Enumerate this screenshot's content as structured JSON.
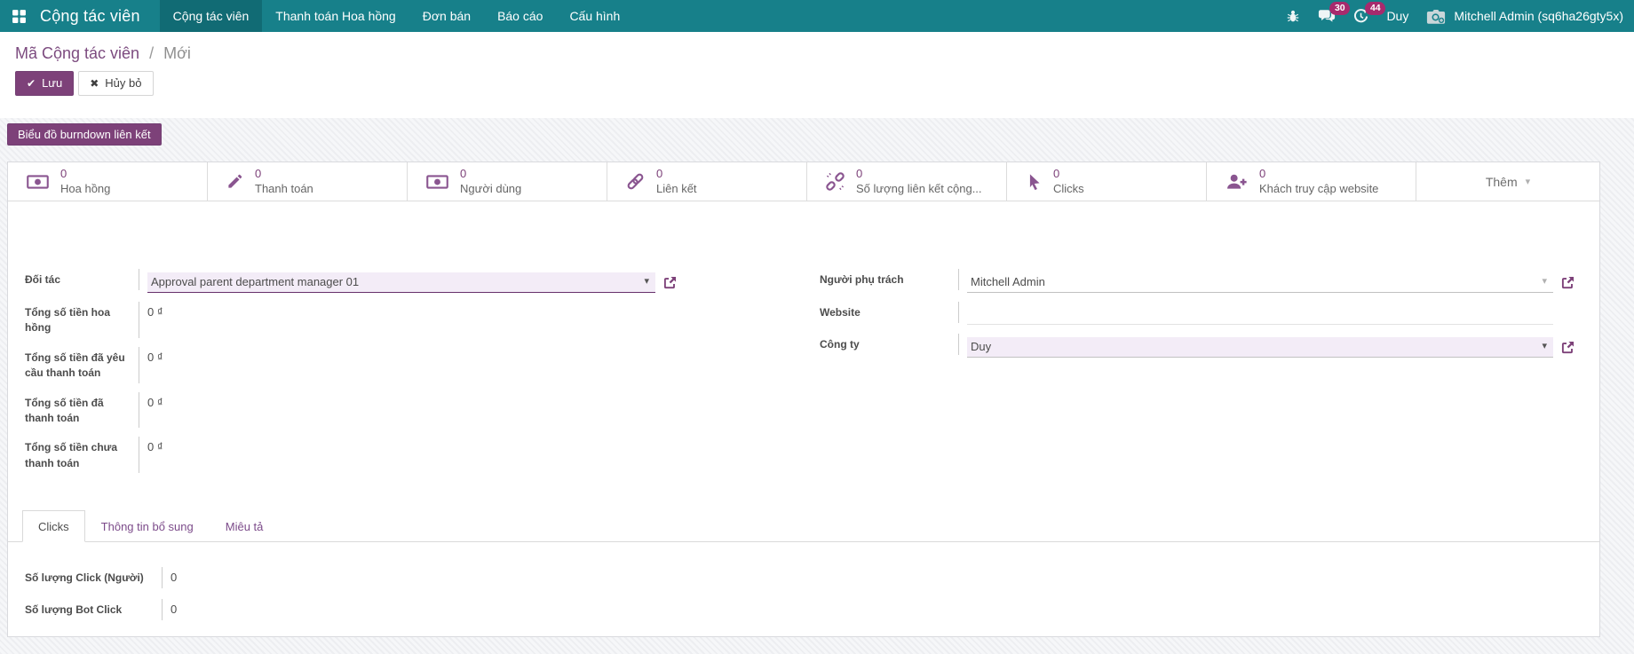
{
  "colors": {
    "topbar_bg": "#17808a",
    "topbar_active_bg": "#116b74",
    "accent_purple": "#7d4179",
    "badge_magenta": "#a72a6d",
    "icon_purple": "#8a5590",
    "link_purple": "#7c4b7f",
    "lavender_field_bg": "#f3ecf7"
  },
  "topbar": {
    "brand": "Cộng tác viên",
    "menu": [
      {
        "label": "Cộng tác viên",
        "active": true
      },
      {
        "label": "Thanh toán Hoa hồng",
        "active": false
      },
      {
        "label": "Đơn bán",
        "active": false
      },
      {
        "label": "Báo cáo",
        "active": false
      },
      {
        "label": "Cấu hình",
        "active": false
      }
    ],
    "systray": {
      "messages_count": "30",
      "activities_count": "44",
      "company": "Duy",
      "user": "Mitchell Admin (sq6ha26gty5x)"
    }
  },
  "control_panel": {
    "breadcrumb": {
      "parent": "Mã Cộng tác viên",
      "separator": "/",
      "current": "Mới"
    },
    "save_label": "Lưu",
    "discard_label": "Hủy bỏ",
    "burndown_label": "Biểu đồ burndown liên kết"
  },
  "stat_buttons": [
    {
      "icon": "money-bill-icon",
      "value": "0",
      "label": "Hoa hồng"
    },
    {
      "icon": "pencil-icon",
      "value": "0",
      "label": "Thanh toán"
    },
    {
      "icon": "money-bill-icon",
      "value": "0",
      "label": "Người dùng"
    },
    {
      "icon": "chain-link-icon",
      "value": "0",
      "label": "Liên kết"
    },
    {
      "icon": "broken-chain-icon",
      "value": "0",
      "label": "Số lượng liên kết cộng..."
    },
    {
      "icon": "mouse-pointer-icon",
      "value": "0",
      "label": "Clicks"
    },
    {
      "icon": "user-plus-icon",
      "value": "0",
      "label": "Khách truy cập website"
    }
  ],
  "more_button_label": "Thêm",
  "form": {
    "partner": {
      "label": "Đối tác",
      "value": "Approval parent department manager 01"
    },
    "total_commission": {
      "label": "Tổng số tiền hoa hồng",
      "value": "0 ₫"
    },
    "total_requested": {
      "label": "Tổng số tiền đã yêu cầu thanh toán",
      "value": "0 ₫"
    },
    "total_paid": {
      "label": "Tổng số tiền đã thanh toán",
      "value": "0 ₫"
    },
    "total_unpaid": {
      "label": "Tổng số tiền chưa thanh toán",
      "value": "0 ₫"
    },
    "responsible": {
      "label": "Người phụ trách",
      "value": "Mitchell Admin"
    },
    "website": {
      "label": "Website",
      "value": ""
    },
    "company": {
      "label": "Công ty",
      "value": "Duy"
    }
  },
  "tabs": [
    {
      "label": "Clicks",
      "active": true
    },
    {
      "label": "Thông tin bổ sung",
      "active": false
    },
    {
      "label": "Miêu tả",
      "active": false
    }
  ],
  "clicks_tab": {
    "rows": [
      {
        "label": "Số lượng Click (Người)",
        "value": "0"
      },
      {
        "label": "Số lượng Bot Click",
        "value": "0"
      }
    ]
  }
}
